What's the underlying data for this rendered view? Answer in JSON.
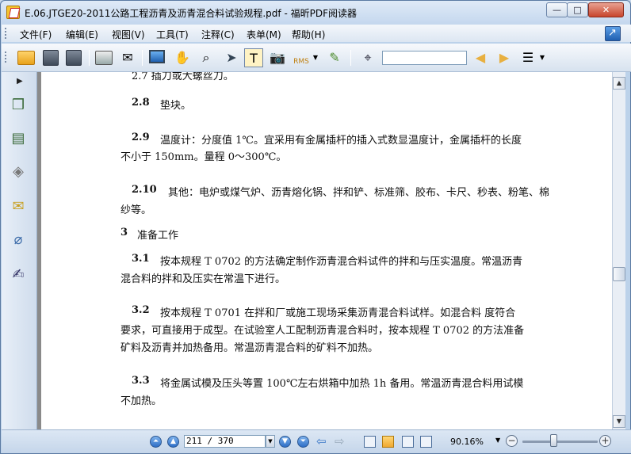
{
  "window": {
    "title": "E.06.JTGE20-2011公路工程沥青及沥青混合料试验规程.pdf - 福昕PDF阅读器",
    "minimize_glyph": "—",
    "maximize_glyph": "□",
    "close_glyph": "✕"
  },
  "menu": {
    "items": [
      {
        "label": "文件(F)"
      },
      {
        "label": "编辑(E)"
      },
      {
        "label": "视图(V)"
      },
      {
        "label": "工具(T)"
      },
      {
        "label": "注释(C)"
      },
      {
        "label": "表单(M)"
      },
      {
        "label": "帮助(H)"
      }
    ]
  },
  "toolbar": {
    "search_value": "",
    "icons": [
      "open-folder-icon",
      "save-icon",
      "save-as-icon",
      "print-icon",
      "email-icon",
      "fullscreen-icon",
      "hand-tool-icon",
      "zoom-tool-icon",
      "select-arrow-icon",
      "text-select-icon",
      "snapshot-icon",
      "rms-lock-icon",
      "sign-icon",
      "binoculars-icon",
      "find-prev-icon",
      "find-next-icon",
      "find-options-icon"
    ],
    "rms_label": "RMS"
  },
  "document": {
    "lines": [
      {
        "text": "2.7  插刀或大螺丝刀。",
        "bold_prefix": ""
      },
      {
        "num": "2.8",
        "text": "垫块。"
      },
      {
        "num": "2.9",
        "text": "温度计：分度值 1℃。宜采用有金属插杆的插入式数显温度计，金属插杆的长度"
      },
      {
        "text": "不小于 150mm。量程 0～300℃。"
      },
      {
        "num": "2.10",
        "text": "其他：电炉或煤气炉、沥青熔化锅、拌和铲、标准筛、胶布、卡尺、秒表、粉笔、棉"
      },
      {
        "text": "纱等。"
      },
      {
        "num": "3",
        "text": "准备工作"
      },
      {
        "num": "3.1",
        "text": "按本规程 T 0702 的方法确定制作沥青混合料试件的拌和与压实温度。常温沥青"
      },
      {
        "text": "混合料的拌和及压实在常温下进行。"
      },
      {
        "num": "3.2",
        "text": "按本规程 T 0701 在拌和厂或施工现场采集沥青混合料试样。如混合料    度符合"
      },
      {
        "text": "要求，可直接用于成型。在试验室人工配制沥青混合料时，按本规程 T 0702 的方法准备"
      },
      {
        "text": "矿料及沥青并加热备用。常温沥青混合料的矿料不加热。"
      },
      {
        "num": "3.3",
        "text": "将金属试模及压头等置 100℃左右烘箱中加热 1h 备用。常温沥青混合料用试模"
      },
      {
        "text": "不加热。"
      }
    ]
  },
  "status": {
    "page_field": "211 / 370",
    "zoom": "90.16%",
    "zoom_level_fraction": 0.41
  }
}
